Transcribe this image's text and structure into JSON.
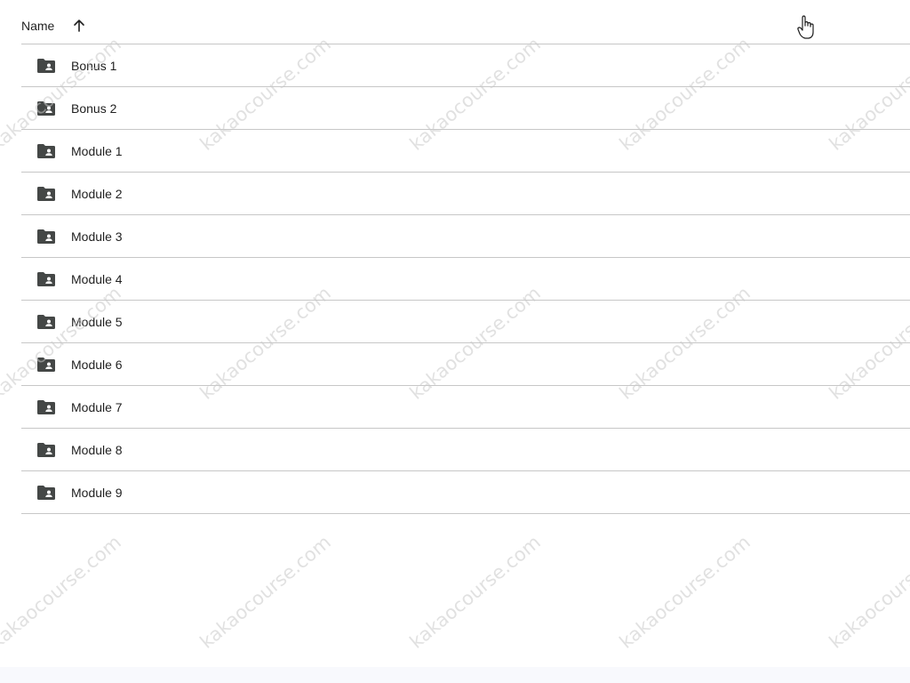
{
  "list_header": {
    "name_label": "Name",
    "sort_icon": "arrow-up-icon"
  },
  "rows": [
    {
      "label": "Bonus 1",
      "icon": "shared-folder-icon"
    },
    {
      "label": "Bonus 2",
      "icon": "shared-folder-icon"
    },
    {
      "label": "Module 1",
      "icon": "shared-folder-icon"
    },
    {
      "label": "Module 2",
      "icon": "shared-folder-icon"
    },
    {
      "label": "Module 3",
      "icon": "shared-folder-icon"
    },
    {
      "label": "Module 4",
      "icon": "shared-folder-icon"
    },
    {
      "label": "Module 5",
      "icon": "shared-folder-icon"
    },
    {
      "label": "Module 6",
      "icon": "shared-folder-icon"
    },
    {
      "label": "Module 7",
      "icon": "shared-folder-icon"
    },
    {
      "label": "Module 8",
      "icon": "shared-folder-icon"
    },
    {
      "label": "Module 9",
      "icon": "shared-folder-icon"
    }
  ],
  "watermark": "kakaocourse.com",
  "colors": {
    "divider": "#c7c7c7",
    "icon": "#444746",
    "text": "#1f1f1f",
    "watermark": "#c8c8c8"
  }
}
